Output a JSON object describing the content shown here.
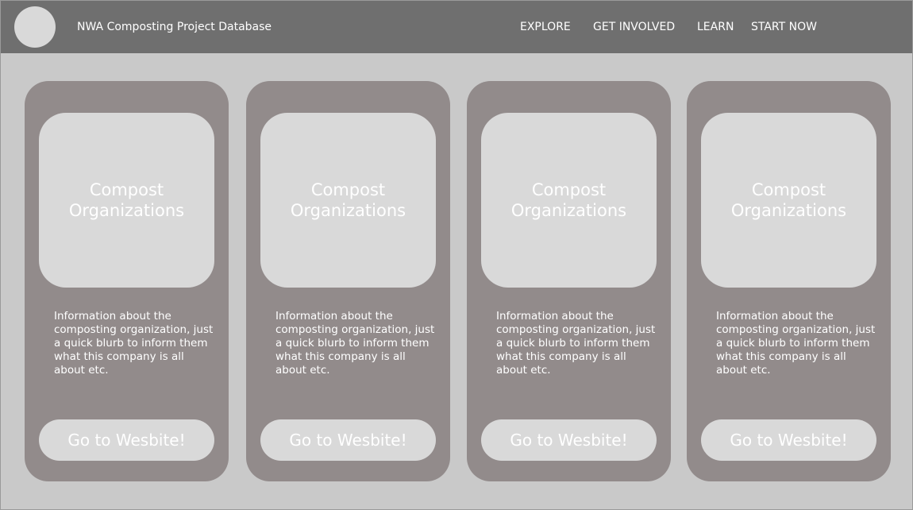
{
  "header": {
    "title": "NWA Composting Project Database",
    "nav": {
      "explore": "EXPLORE",
      "get_involved": "GET INVOLVED",
      "learn": "LEARN",
      "start_now": "START NOW"
    }
  },
  "cards": [
    {
      "image_label": "Compost Organizations",
      "description": "Information about the composting organization, just a quick blurb to inform them what this company is all about etc.",
      "button_label": "Go to Wesbite!"
    },
    {
      "image_label": "Compost Organizations",
      "description": "Information about the composting organization, just a quick blurb to inform them what this company is all about etc.",
      "button_label": "Go to Wesbite!"
    },
    {
      "image_label": "Compost Organizations",
      "description": "Information about the composting organization, just a quick blurb to inform them what this company is all about etc.",
      "button_label": "Go to Wesbite!"
    },
    {
      "image_label": "Compost Organizations",
      "description": "Information about the composting organization, just a quick blurb to inform them what this company is all about etc.",
      "button_label": "Go to Wesbite!"
    }
  ],
  "colors": {
    "background": "#c9c9c9",
    "header": "#6f6f6f",
    "card": "#928b8b",
    "placeholder": "#d9d9d9",
    "text": "#ffffff"
  }
}
